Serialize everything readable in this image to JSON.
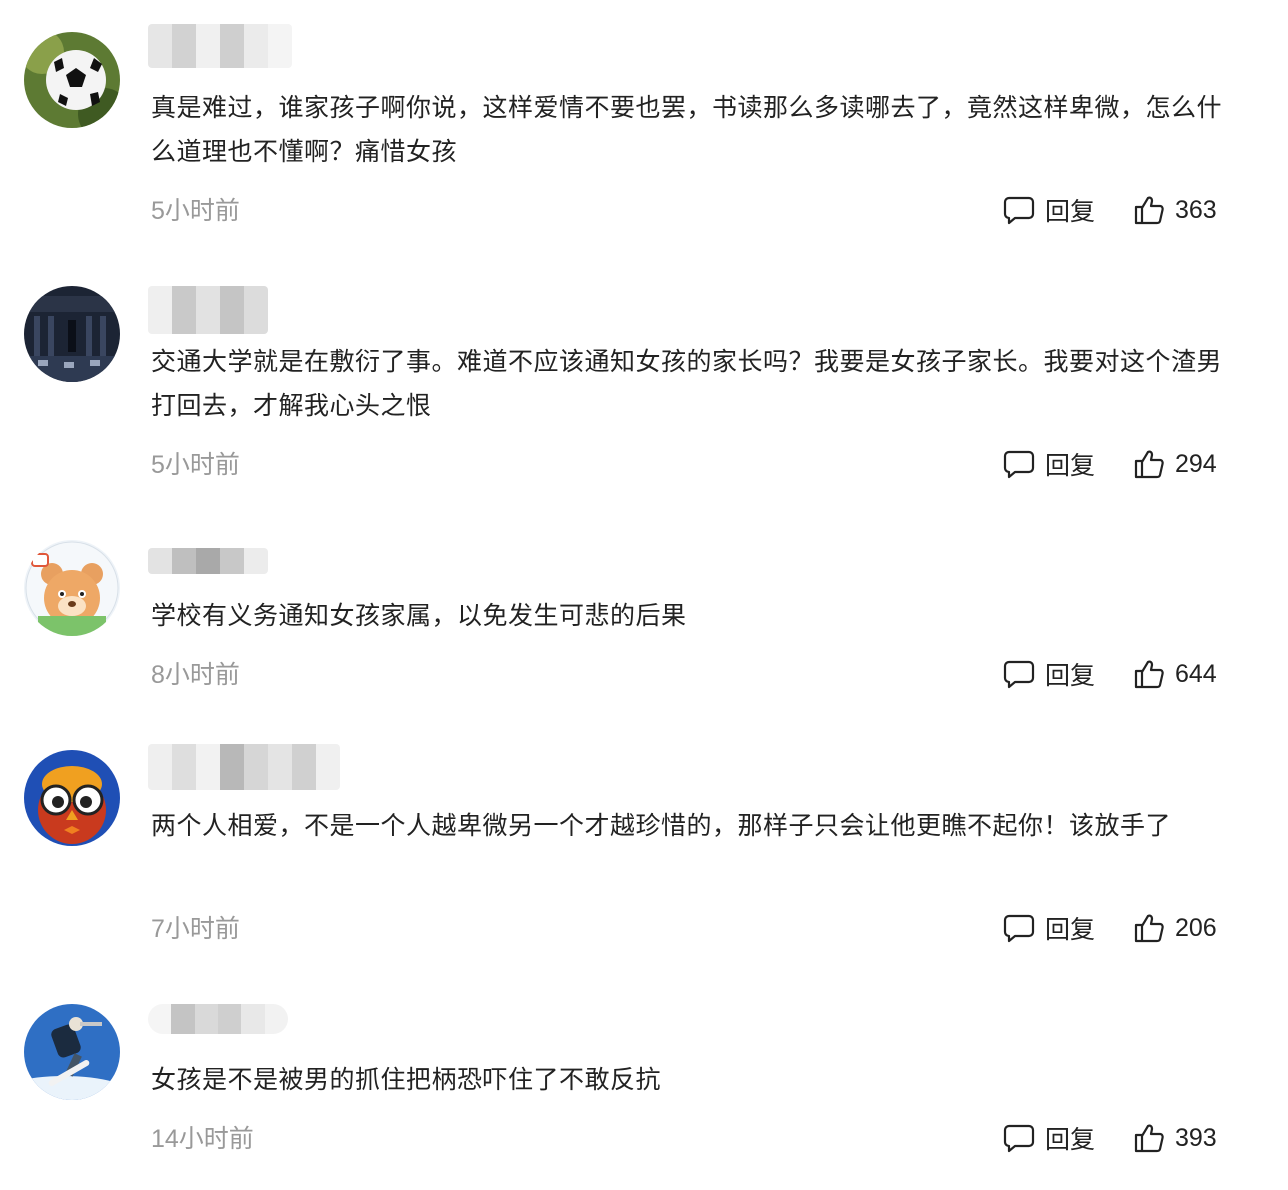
{
  "comments": [
    {
      "avatar_icon": "soccer-ball-avatar",
      "username": "",
      "text": "真是难过，谁家孩子啊你说，这样爱情不要也罢，书读那么多读哪去了，竟然这样卑微，怎么什么道理也不懂啊？痛惜女孩",
      "time": "5小时前",
      "reply_label": "回复",
      "likes": "363"
    },
    {
      "avatar_icon": "dark-building-avatar",
      "username": "",
      "text": "交通大学就是在敷衍了事。难道不应该通知女孩的家长吗？我要是女孩子家长。我要对这个渣男打回去，才解我心头之恨",
      "time": "5小时前",
      "reply_label": "回复",
      "likes": "294"
    },
    {
      "avatar_icon": "cartoon-bear-avatar",
      "username": "",
      "text": "学校有义务通知女孩家属，以免发生可悲的后果",
      "time": "8小时前",
      "reply_label": "回复",
      "likes": "644"
    },
    {
      "avatar_icon": "cartoon-owl-avatar",
      "username": "",
      "text": "两个人相爱，不是一个人越卑微另一个才越珍惜的，那样子只会让他更瞧不起你！该放手了",
      "time": "7小时前",
      "reply_label": "回复",
      "likes": "206"
    },
    {
      "avatar_icon": "snowboarder-avatar",
      "username": "",
      "text": "女孩是不是被男的抓住把柄恐吓住了不敢反抗",
      "time": "14小时前",
      "reply_label": "回复",
      "likes": "393"
    }
  ],
  "colors": {
    "text": "#222222",
    "muted": "#999999",
    "blur_light": "#eeeeee",
    "blur_dark": "#c8c8c8"
  }
}
